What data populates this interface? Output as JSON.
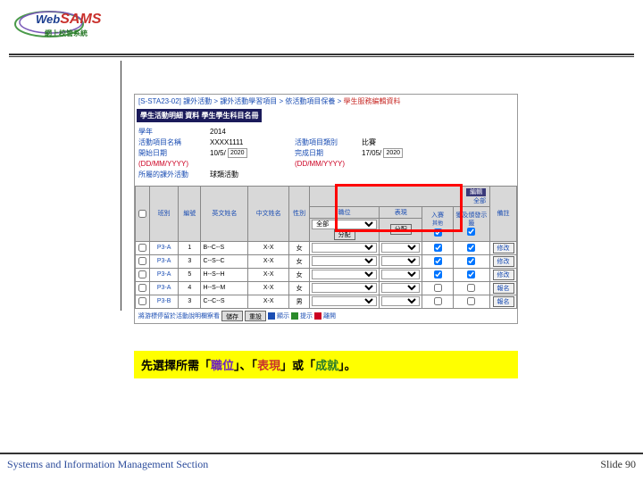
{
  "logo": {
    "web": "Web",
    "sams": "SAMS",
    "subtitle": "網上校管系統"
  },
  "breadcrumb": {
    "code": "[S-STA23-02]",
    "path": "課外活動 > 課外活動學習項目 > 依活動項目保養 >",
    "last": "學生服務編輯資料"
  },
  "header_bar": "學生活動明細 資料   學生學生科目名冊",
  "form": {
    "level_label": "學年",
    "level_value": "2014",
    "name_label": "活動項目名稱",
    "name_value": "XXXX1111",
    "type_label": "活動項目類別",
    "type_value": "比賽",
    "start_label": "開始日期",
    "start_sub": "(DD/MM/YYYY)",
    "start_value": "10/5/",
    "start_year": "2020",
    "end_label": "完成日期",
    "end_sub": "(DD/MM/YYYY)",
    "end_value": "17/05/",
    "end_year": "2020",
    "cat_label": "所屬的課外活動",
    "cat_value": "球類活動"
  },
  "grid": {
    "head_edit": "編輯",
    "head_all": "全部",
    "cols": {
      "checkbox": "",
      "class": "班別",
      "no": "編號",
      "enname": "英文姓名",
      "cnname": "中文姓名",
      "sex": "性別",
      "post": "職位",
      "perf": "表現",
      "deg": "入賽",
      "outside": "獲及頒發示籤",
      "note": "備註"
    },
    "all_opt": "全部",
    "sub_btn": "分配",
    "rows": [
      {
        "class": "P3-A",
        "no": "1",
        "en": "B--C--S",
        "cn": "X-X",
        "sex": "女",
        "note": "修改"
      },
      {
        "class": "P3-A",
        "no": "3",
        "en": "C--S--C",
        "cn": "X-X",
        "sex": "女",
        "note": "修改"
      },
      {
        "class": "P3-A",
        "no": "5",
        "en": "H--S--H",
        "cn": "X-X",
        "sex": "女",
        "note": "修改"
      },
      {
        "class": "P3-A",
        "no": "4",
        "en": "H--S--M",
        "cn": "X-X",
        "sex": "女",
        "note": "報名"
      },
      {
        "class": "P3-B",
        "no": "3",
        "en": "C--C--S",
        "cn": "X-X",
        "sex": "男",
        "note": "報名"
      }
    ]
  },
  "footer_panel": {
    "text": "將游標停留於活動說明欄察看",
    "btns": [
      "儲存",
      "重設"
    ],
    "legend": [
      "顯示",
      "提示",
      "離開"
    ]
  },
  "instruction": {
    "pre": "先選擇所需",
    "q1": "「",
    "kw1": "職位",
    "q2": "」、「",
    "kw2": "表現",
    "q3": "」或「",
    "kw3": "成就",
    "q4": "」。"
  },
  "watermark": "Web.SAMS",
  "footer": {
    "left": "Systems and Information Management Section",
    "right_label": "Slide",
    "right_num": "90"
  }
}
